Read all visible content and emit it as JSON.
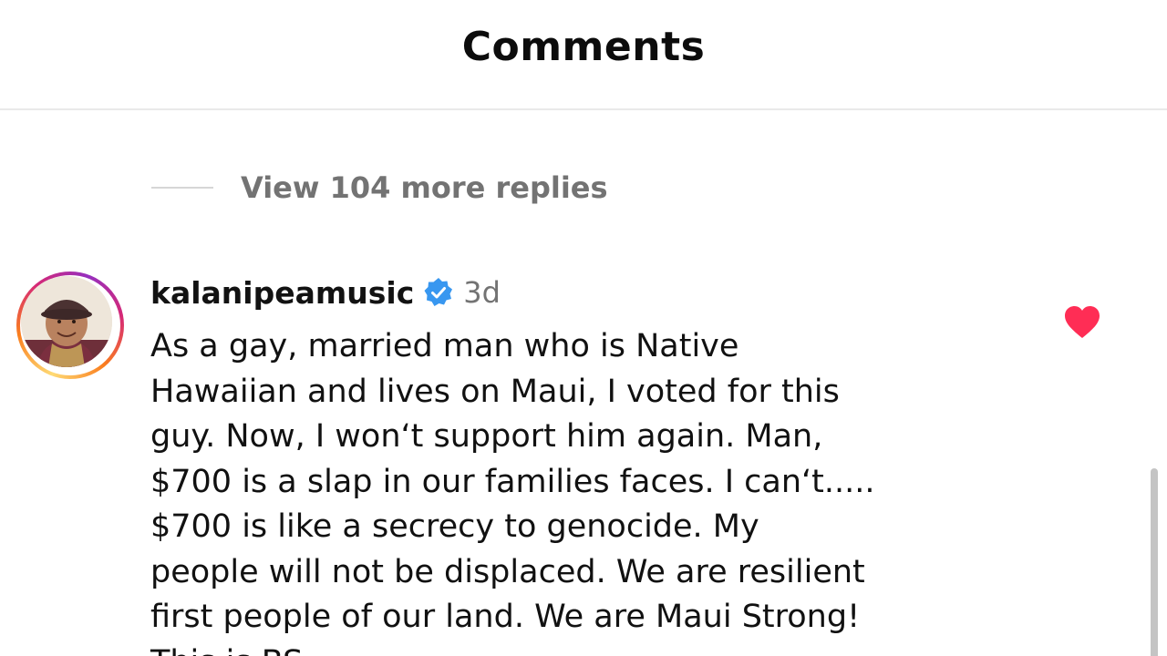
{
  "header": {
    "title": "Comments"
  },
  "replies": {
    "view_more_label": "View 104 more replies"
  },
  "comment": {
    "username": "kalanipeamusic",
    "verified": true,
    "timestamp": "3d",
    "text": "As a gay, married man who is Native\nHawaiian and lives on Maui, I voted for this\nguy. Now, I won‘t support him again. Man,\n$700 is a slap in our families faces. I can‘t.....\n$700 is like a secrecy to genocide. My\npeople will not be displaced. We are resilient\nfirst people of our land. We are Maui Strong!\nThis is BS",
    "liked": true
  },
  "icons": {
    "verified": "verified-badge-icon",
    "like": "heart-icon",
    "avatar": "user-avatar"
  },
  "colors": {
    "like_red": "#ff2d55",
    "verified_blue": "#3897f0",
    "muted_text": "#737373",
    "divider": "#e9e9e9"
  }
}
